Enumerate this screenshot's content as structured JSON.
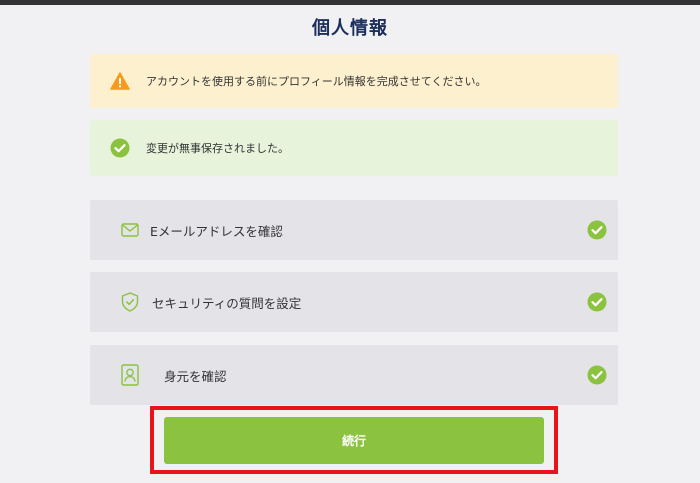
{
  "page": {
    "title": "個人情報"
  },
  "alerts": {
    "warning": {
      "text": "アカウントを使用する前にプロフィール情報を完成させてください。",
      "icon": "warning-icon",
      "color": "#f59b1c"
    },
    "success": {
      "text": "変更が無事保存されました。",
      "icon": "check-circle-icon",
      "color": "#8bc23f"
    }
  },
  "steps": [
    {
      "label": "Eメールアドレスを確認",
      "icon": "mail-icon",
      "status": "completed"
    },
    {
      "label": "セキュリティの質問を設定",
      "icon": "shield-check-icon",
      "status": "completed"
    },
    {
      "label": "身元を確認",
      "icon": "id-card-icon",
      "status": "completed"
    }
  ],
  "actions": {
    "continue_label": "続行"
  },
  "colors": {
    "accent": "#8bc23f",
    "title": "#1c2e5a",
    "highlight": "#e8141a",
    "warning_bg": "#fdf0cf",
    "success_bg": "#e8f3dc",
    "step_bg": "#e3e3e8"
  }
}
